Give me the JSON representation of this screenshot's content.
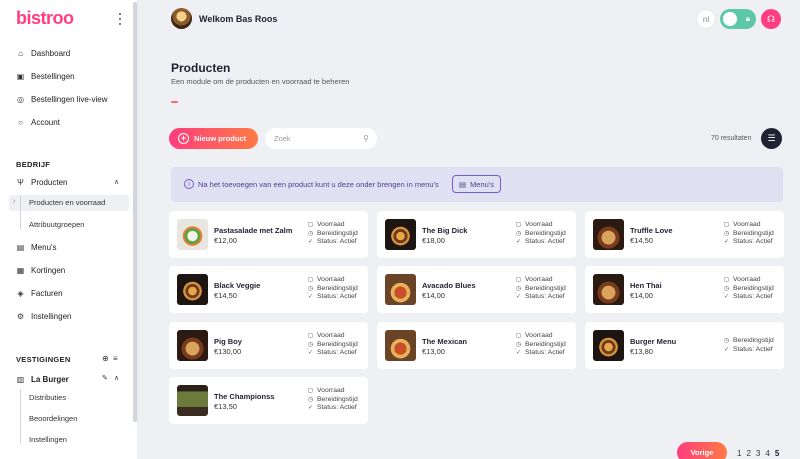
{
  "brand": {
    "logo": "bistroo",
    "accent": "#ff3d7f"
  },
  "sidebar": {
    "main_nav": [
      {
        "label": "Dashboard",
        "icon": "home-icon"
      },
      {
        "label": "Bestellingen",
        "icon": "bag-icon"
      },
      {
        "label": "Bestellingen live-view",
        "icon": "live-icon"
      },
      {
        "label": "Account",
        "icon": "user-icon"
      }
    ],
    "bedrijf_title": "BEDRIJF",
    "producten_label": "Producten",
    "producten_sub": [
      "Producten en voorraad",
      "Attribuutgroepen"
    ],
    "bedrijf_nav": [
      {
        "label": "Menu's",
        "icon": "menu-book-icon"
      },
      {
        "label": "Kortingen",
        "icon": "discount-icon"
      },
      {
        "label": "Facturen",
        "icon": "tag-icon"
      },
      {
        "label": "Instellingen",
        "icon": "settings-icon"
      }
    ],
    "vestigingen_title": "VESTIGINGEN",
    "location_label": "La Burger",
    "location_sub": [
      "Distributies",
      "Beoordelingen",
      "Instellingen"
    ]
  },
  "header": {
    "welcome": "Welkom Bas Roos",
    "language": "nl"
  },
  "page": {
    "title": "Producten",
    "subtitle": "Een module om de producten en voorraad te beheren"
  },
  "toolbar": {
    "new_product": "Nieuw product",
    "search_placeholder": "Zoek",
    "results": "70 resultaten"
  },
  "info": {
    "text": "Na het toevoegen van een product kunt u deze onder brengen in menu's",
    "button": "Menu's"
  },
  "products": [
    {
      "name": "Pastasalade met Zalm",
      "price": "€12,00",
      "status": [
        "Voorraad",
        "Bereidingstijd",
        "Status: Actief"
      ]
    },
    {
      "name": "The Big Dick",
      "price": "€18,00",
      "status": [
        "Voorraad",
        "Bereidingstijd",
        "Status: Actief"
      ]
    },
    {
      "name": "Truffle Love",
      "price": "€14,50",
      "status": [
        "Voorraad",
        "Bereidingstijd",
        "Status: Actief"
      ]
    },
    {
      "name": "Black Veggie",
      "price": "€14,50",
      "status": [
        "Voorraad",
        "Bereidingstijd",
        "Status: Actief"
      ]
    },
    {
      "name": "Avacado Blues",
      "price": "€14,00",
      "status": [
        "Voorraad",
        "Bereidingstijd",
        "Status: Actief"
      ]
    },
    {
      "name": "Hen Thai",
      "price": "€14,00",
      "status": [
        "Voorraad",
        "Bereidingstijd",
        "Status: Actief"
      ]
    },
    {
      "name": "Pig Boy",
      "price": "€130,00",
      "status": [
        "Voorraad",
        "Bereidingstijd",
        "Status: Actief"
      ]
    },
    {
      "name": "The Mexican",
      "price": "€13,00",
      "status": [
        "Voorraad",
        "Bereidingstijd",
        "Status: Actief"
      ]
    },
    {
      "name": "Burger Menu",
      "price": "€13,80",
      "status": [
        "Bereidingstijd",
        "Status: Actief"
      ]
    },
    {
      "name": "The Championss",
      "price": "€13,50",
      "status": [
        "Voorraad",
        "Bereidingstijd",
        "Status: Actief"
      ]
    }
  ],
  "pagination": {
    "prev": "Vorige",
    "pages": [
      "1",
      "2",
      "3",
      "4",
      "5"
    ],
    "current": "5"
  }
}
